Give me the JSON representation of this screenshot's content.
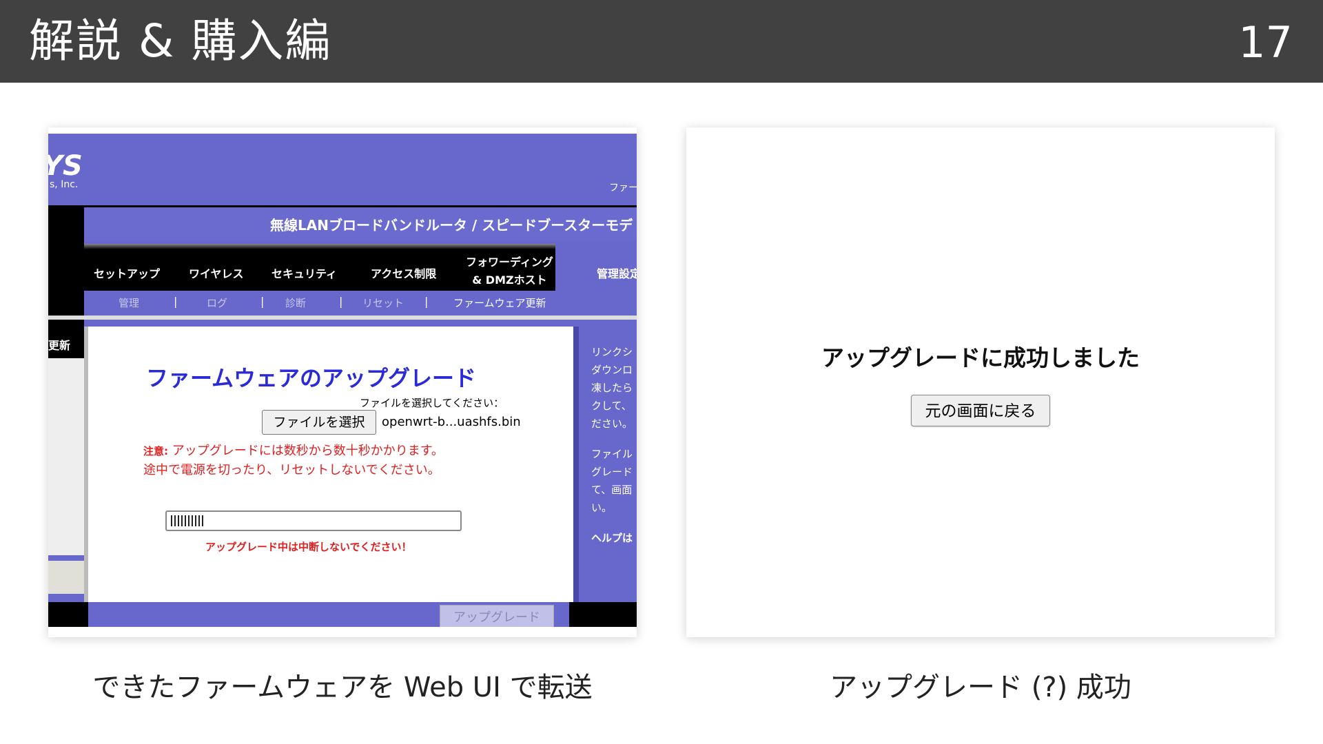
{
  "slide": {
    "title": "解説 & 購入編",
    "page_number": "17"
  },
  "left_panel": {
    "logo": "YS",
    "logo_sub": "s, Inc.",
    "top_right_link": "ファー",
    "product_name": "無線LANブロードバンドルータ / スピードブースターモデ",
    "nav_tabs": [
      "セットアップ",
      "ワイヤレス",
      "セキュリティ",
      "アクセス制限",
      "フォワーディング",
      "& DMZホスト",
      "管理設定"
    ],
    "sub_tabs": [
      "管理",
      "ログ",
      "診断",
      "リセット",
      "ファームウェア更新"
    ],
    "sub_separator": "|",
    "side_label": "更新",
    "fw_title": "ファームウェアのアップグレード",
    "select_label": "ファイルを選択してください：",
    "file_button": "ファイルを選択",
    "file_name": "openwrt-b...uashfs.bin",
    "warning_prefix": "注意:",
    "warning_line1": "アップグレードには数秒から数十秒かかります。",
    "warning_line2": "途中で電源を切ったり、リセットしないでください。",
    "progress_fraction": 0.12,
    "progress_note": "アップグレード中は中断しないでください！",
    "help_lines_1": [
      "リンクシ",
      "ダウンロ",
      "凍したら",
      "クして、",
      "ださい。"
    ],
    "help_lines_2": [
      "ファイル",
      "グレード",
      "て、画面",
      "い。"
    ],
    "help_lines_3": [
      "ヘルプは"
    ],
    "upgrade_button": "アップグレード",
    "colors": {
      "ui_purple": "#6868cc",
      "title_blue": "#2a2ad8",
      "warning_red": "#e02020"
    }
  },
  "right_panel": {
    "message": "アップグレードに成功しました",
    "back_button": "元の画面に戻る"
  },
  "captions": {
    "left": "できたファームウェアを Web UI で転送",
    "right": "アップグレード (?) 成功"
  }
}
